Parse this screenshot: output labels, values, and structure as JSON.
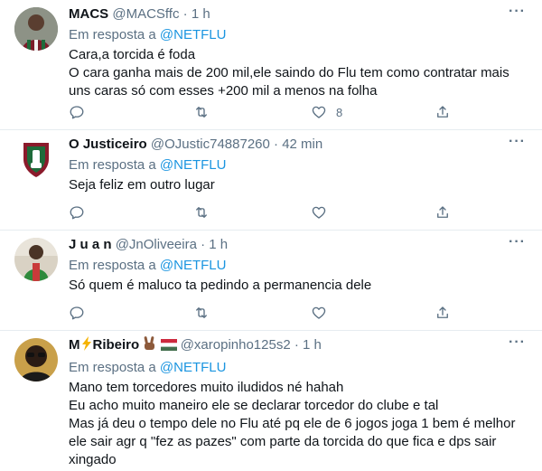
{
  "reply_prefix": "Em resposta a",
  "tweets": [
    {
      "name": "MACS",
      "handle": "@MACSffc",
      "dot": "·",
      "time": "1 h",
      "mention": "@NETFLU",
      "lines": [
        "Cara,a torcida é foda",
        "O cara ganha mais de 200 mil,ele saindo do Flu tem como contratar mais",
        "uns caras só com esses +200 mil a menos na folha"
      ],
      "like_count": "8"
    },
    {
      "name": "O Justiceiro",
      "handle": "@OJustic74887260",
      "dot": "·",
      "time": "42 min",
      "mention": "@NETFLU",
      "lines": [
        "Seja feliz em outro lugar"
      ],
      "like_count": ""
    },
    {
      "name": "J u a n",
      "handle": "@JnOliveeira",
      "dot": "·",
      "time": "1 h",
      "mention": "@NETFLU",
      "lines": [
        "Só quem é maluco ta pedindo a permanencia dele"
      ],
      "like_count": ""
    },
    {
      "name_prefix": "M",
      "name_suffix": "Ribeiro",
      "handle": "@xaropinho125s2",
      "dot": "·",
      "time": "1 h",
      "mention": "@NETFLU",
      "lines": [
        "Mano tem torcedores muito iludidos né hahah",
        "Eu acho muito maneiro ele se declarar torcedor do clube e tal",
        "Mas já deu o tempo dele no Flu até pq ele de 6 jogos joga 1 bem é melhor",
        "ele sair agr q \"fez as pazes\" com parte da torcida do que fica e dps sair",
        "xingado"
      ]
    }
  ],
  "colors": {
    "text": "#0f1419",
    "secondary": "#5b7083",
    "link": "#1b95e0",
    "divider": "#e6ecf0"
  },
  "icons": [
    "reply-icon",
    "retweet-icon",
    "like-icon",
    "share-icon",
    "more-icon"
  ]
}
